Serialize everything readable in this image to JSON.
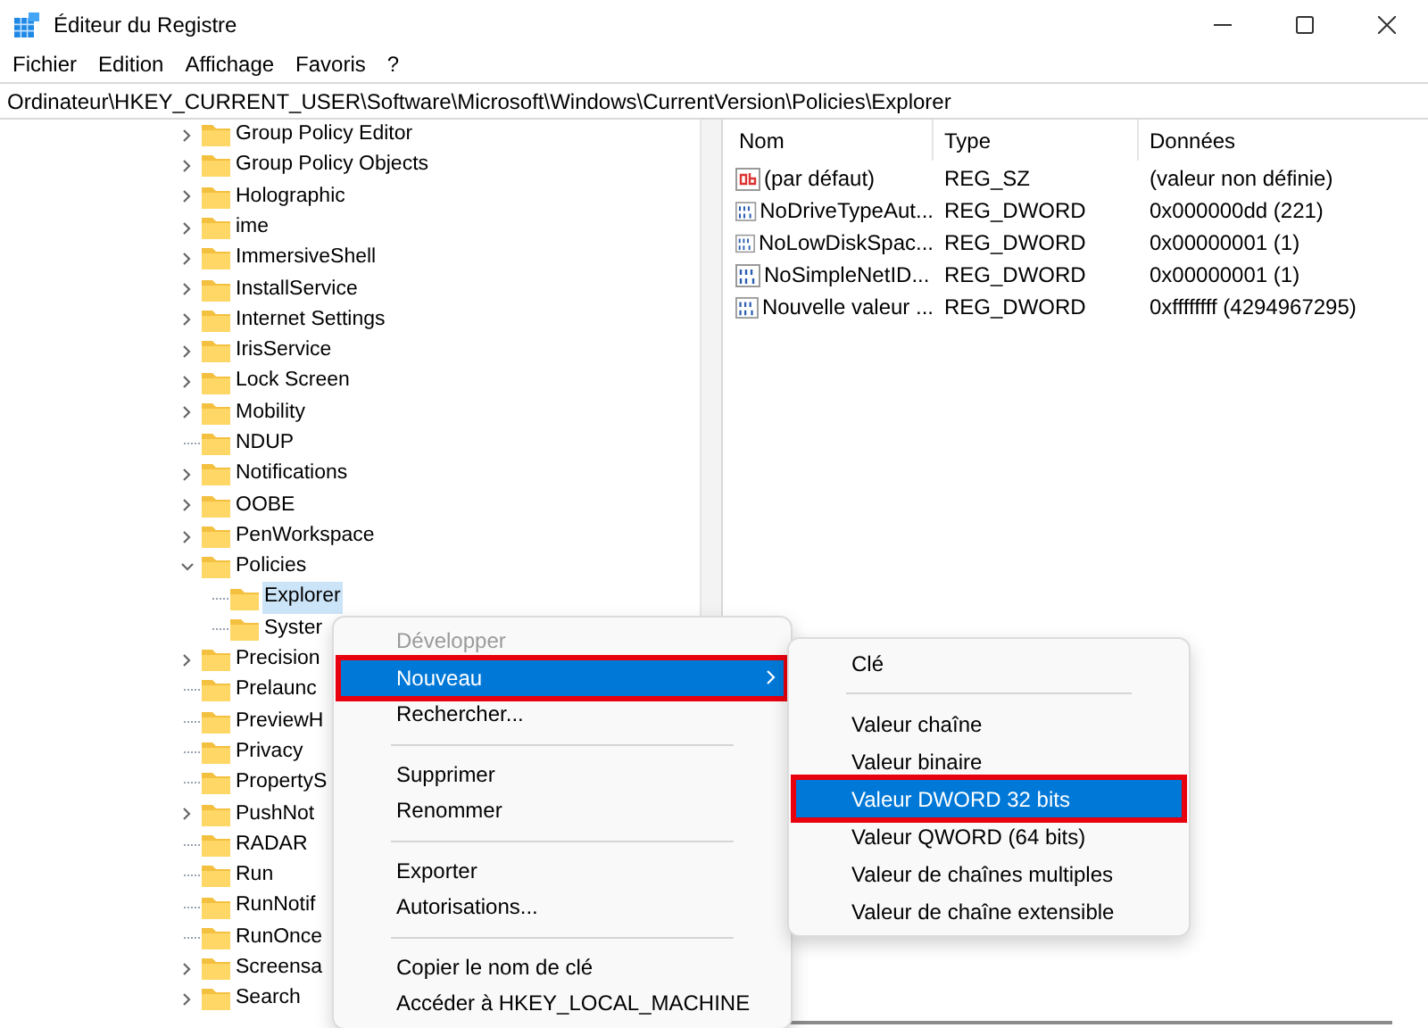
{
  "window": {
    "title": "Éditeur du Registre"
  },
  "menu": [
    "Fichier",
    "Edition",
    "Affichage",
    "Favoris",
    "?"
  ],
  "address": "Ordinateur\\HKEY_CURRENT_USER\\Software\\Microsoft\\Windows\\CurrentVersion\\Policies\\Explorer",
  "tree": [
    {
      "label": "Group Policy Editor",
      "expandable": true,
      "expanded": false,
      "selected": false
    },
    {
      "label": "Group Policy Objects",
      "expandable": true,
      "expanded": false,
      "selected": false
    },
    {
      "label": "Holographic",
      "expandable": true,
      "expanded": false,
      "selected": false
    },
    {
      "label": "ime",
      "expandable": true,
      "expanded": false,
      "selected": false
    },
    {
      "label": "ImmersiveShell",
      "expandable": true,
      "expanded": false,
      "selected": false
    },
    {
      "label": "InstallService",
      "expandable": true,
      "expanded": false,
      "selected": false
    },
    {
      "label": "Internet Settings",
      "expandable": true,
      "expanded": false,
      "selected": false
    },
    {
      "label": "IrisService",
      "expandable": true,
      "expanded": false,
      "selected": false
    },
    {
      "label": "Lock Screen",
      "expandable": true,
      "expanded": false,
      "selected": false
    },
    {
      "label": "Mobility",
      "expandable": true,
      "expanded": false,
      "selected": false
    },
    {
      "label": "NDUP",
      "expandable": false,
      "selected": false
    },
    {
      "label": "Notifications",
      "expandable": true,
      "expanded": false,
      "selected": false
    },
    {
      "label": "OOBE",
      "expandable": true,
      "expanded": false,
      "selected": false
    },
    {
      "label": "PenWorkspace",
      "expandable": true,
      "expanded": false,
      "selected": false
    },
    {
      "label": "Policies",
      "expandable": true,
      "expanded": true,
      "selected": false,
      "children": [
        {
          "label": "Explorer",
          "expandable": false,
          "selected": true
        },
        {
          "label": "Syster",
          "expandable": false,
          "selected": false
        }
      ]
    },
    {
      "label": "Precision",
      "expandable": true,
      "expanded": false,
      "selected": false
    },
    {
      "label": "Prelaunc",
      "expandable": false,
      "selected": false
    },
    {
      "label": "PreviewH",
      "expandable": false,
      "selected": false
    },
    {
      "label": "Privacy",
      "expandable": false,
      "selected": false
    },
    {
      "label": "PropertyS",
      "expandable": false,
      "selected": false
    },
    {
      "label": "PushNot",
      "expandable": true,
      "expanded": false,
      "selected": false
    },
    {
      "label": "RADAR",
      "expandable": false,
      "selected": false
    },
    {
      "label": "Run",
      "expandable": false,
      "selected": false
    },
    {
      "label": "RunNotif",
      "expandable": false,
      "selected": false
    },
    {
      "label": "RunOnce",
      "expandable": false,
      "selected": false
    },
    {
      "label": "Screensa",
      "expandable": true,
      "expanded": false,
      "selected": false
    },
    {
      "label": "Search",
      "expandable": true,
      "expanded": false,
      "selected": false
    }
  ],
  "values": {
    "columns": [
      "Nom",
      "Type",
      "Données"
    ],
    "rows": [
      {
        "kind": "string",
        "name": "(par défaut)",
        "type": "REG_SZ",
        "data": "(valeur non définie)"
      },
      {
        "kind": "dword",
        "name": "NoDriveTypeAut...",
        "type": "REG_DWORD",
        "data": "0x000000dd (221)"
      },
      {
        "kind": "dword",
        "name": "NoLowDiskSpac...",
        "type": "REG_DWORD",
        "data": "0x00000001 (1)"
      },
      {
        "kind": "dword",
        "name": "NoSimpleNetID...",
        "type": "REG_DWORD",
        "data": "0x00000001 (1)"
      },
      {
        "kind": "dword",
        "name": "Nouvelle valeur ...",
        "type": "REG_DWORD",
        "data": "0xffffffff (4294967295)"
      }
    ]
  },
  "context_menu": [
    {
      "kind": "item",
      "label": "Développer",
      "disabled": true,
      "selected": false,
      "submenu": false
    },
    {
      "kind": "item",
      "label": "Nouveau",
      "disabled": false,
      "selected": true,
      "submenu": true
    },
    {
      "kind": "item",
      "label": "Rechercher...",
      "disabled": false,
      "selected": false,
      "submenu": false
    },
    {
      "kind": "separator"
    },
    {
      "kind": "item",
      "label": "Supprimer",
      "disabled": false,
      "selected": false,
      "submenu": false
    },
    {
      "kind": "item",
      "label": "Renommer",
      "disabled": false,
      "selected": false,
      "submenu": false
    },
    {
      "kind": "separator"
    },
    {
      "kind": "item",
      "label": "Exporter",
      "disabled": false,
      "selected": false,
      "submenu": false
    },
    {
      "kind": "item",
      "label": "Autorisations...",
      "disabled": false,
      "selected": false,
      "submenu": false
    },
    {
      "kind": "separator"
    },
    {
      "kind": "item",
      "label": "Copier le nom de clé",
      "disabled": false,
      "selected": false,
      "submenu": false
    },
    {
      "kind": "item",
      "label": "Accéder à HKEY_LOCAL_MACHINE",
      "disabled": false,
      "selected": false,
      "submenu": false
    }
  ],
  "submenu": [
    {
      "kind": "item",
      "label": "Clé",
      "disabled": false,
      "selected": false,
      "submenu": false
    },
    {
      "kind": "separator"
    },
    {
      "kind": "item",
      "label": "Valeur chaîne",
      "disabled": false,
      "selected": false,
      "submenu": false
    },
    {
      "kind": "item",
      "label": "Valeur binaire",
      "disabled": false,
      "selected": false,
      "submenu": false
    },
    {
      "kind": "item",
      "label": "Valeur DWORD 32 bits",
      "disabled": false,
      "selected": true,
      "submenu": false
    },
    {
      "kind": "item",
      "label": "Valeur QWORD (64 bits)",
      "disabled": false,
      "selected": false,
      "submenu": false
    },
    {
      "kind": "item",
      "label": "Valeur de chaînes multiples",
      "disabled": false,
      "selected": false,
      "submenu": false
    },
    {
      "kind": "item",
      "label": "Valeur de chaîne extensible",
      "disabled": false,
      "selected": false,
      "submenu": false
    }
  ]
}
